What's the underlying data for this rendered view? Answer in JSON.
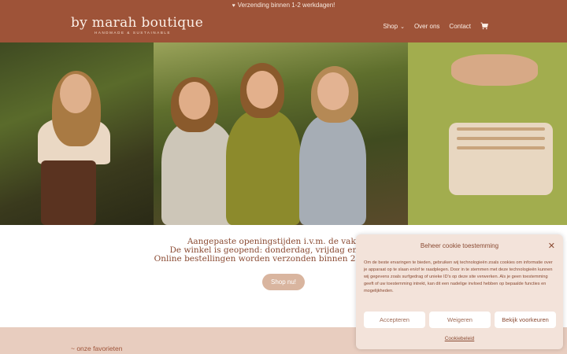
{
  "topbar": {
    "text": "Verzending binnen 1-2 werkdagen!",
    "icon": "heart-icon"
  },
  "brand": {
    "name": "by marah boutique",
    "tagline": "HANDMADE & SUSTAINABLE"
  },
  "nav": {
    "shop": "Shop",
    "about": "Over ons",
    "contact": "Contact",
    "cart_icon": "cart-icon"
  },
  "notice": {
    "line1": "Aangepaste openingstijden i.v.m. de vakantie:",
    "line2": "De winkel is geopend: donderdag, vrijdag en zaterdag",
    "line3": "Online bestellingen worden verzonden binnen 2-3 werkdagen"
  },
  "cta": {
    "label": "Shop nu!"
  },
  "favorites": {
    "label": "~ onze favorieten"
  },
  "cookie": {
    "title": "Beheer cookie toestemming",
    "text": "Om de beste ervaringen te bieden, gebruiken wij technologieën zoals cookies om informatie over je apparaat op te slaan en/of te raadplegen. Door in te stemmen met deze technologieën kunnen wij gegevens zoals surfgedrag of unieke ID's op deze site verwerken. Als je geen toestemming geeft of uw toestemming intrekt, kan dit een nadelige invloed hebben op bepaalde functies en mogelijkheden.",
    "accept": "Accepteren",
    "deny": "Weigeren",
    "preferences": "Bekijk voorkeuren",
    "policy_link": "Cookiebeleid"
  },
  "colors": {
    "brand": "#9e5338",
    "accent": "#d9b59f",
    "band": "#e8cdbf",
    "panel": "#f3e3da"
  }
}
